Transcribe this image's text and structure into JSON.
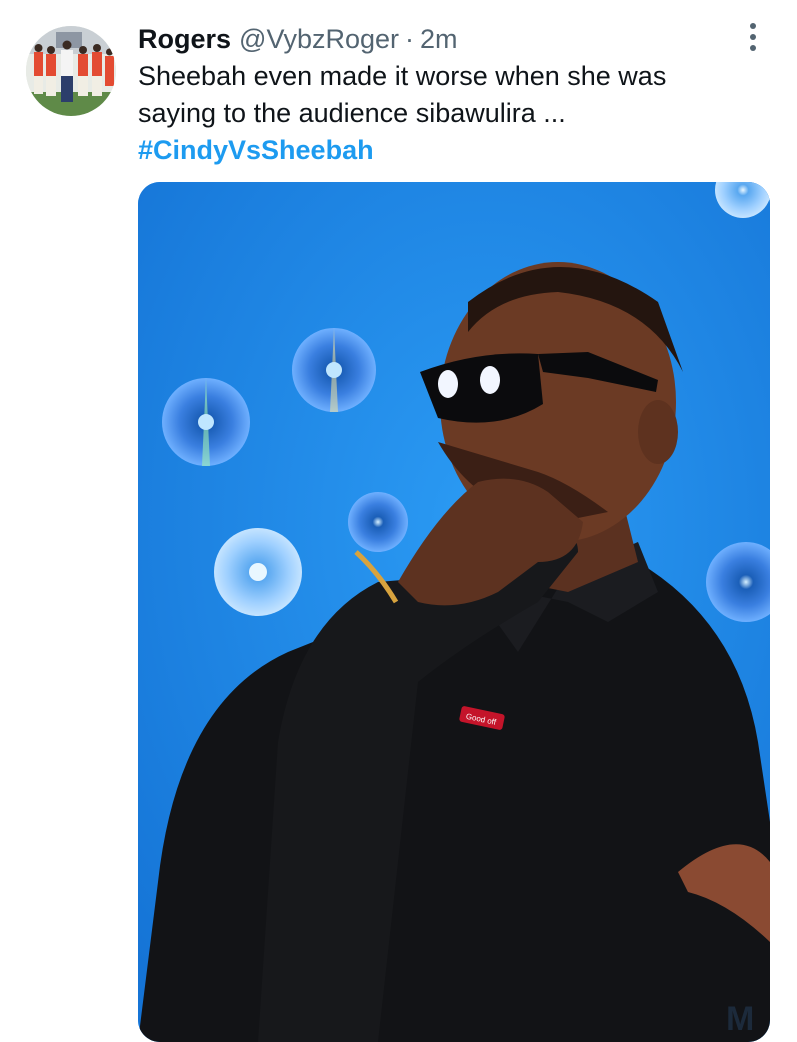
{
  "tweet": {
    "author_name": "Rogers",
    "author_handle": "@VybzRoger",
    "separator": "·",
    "time": "2m",
    "text_line1": "Sheebah even made it worse when she was",
    "text_line2": "saying to the audience sibawulira ...",
    "hashtag": "#CindyVsSheebah"
  },
  "media": {
    "shirt_tag_text": "Good off",
    "watermark": "M"
  },
  "icons": {
    "more": "more-vertical-icon",
    "avatar": "avatar"
  },
  "colors": {
    "link": "#1d9bf0",
    "secondary_text": "#536471",
    "primary_text": "#0f1419",
    "photo_background": "#1f8be8"
  }
}
